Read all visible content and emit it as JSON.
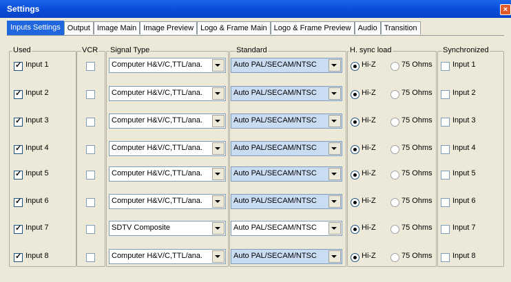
{
  "window": {
    "title": "Settings",
    "close_glyph": "×"
  },
  "tabs": [
    "Inputs Settings",
    "Output",
    "Image Main",
    "Image Preview",
    "Logo & Frame Main",
    "Logo & Frame Preview",
    "Audio",
    "Transition"
  ],
  "group_labels": {
    "used": "Used",
    "vcr": "VCR",
    "signal": "Signal Type",
    "standard": "Standard",
    "hsync": "H. sync load",
    "sync": "Synchronized"
  },
  "radio_labels": {
    "hiz": "Hi-Z",
    "ohm": "75 Ohms"
  },
  "rows": [
    {
      "used": "Input 1",
      "signal": "Computer H&V/C,TTL/ana.",
      "standard": "Auto PAL/SECAM/NTSC",
      "sync": "Input 1"
    },
    {
      "used": "Input 2",
      "signal": "Computer H&V/C,TTL/ana.",
      "standard": "Auto PAL/SECAM/NTSC",
      "sync": "Input 2"
    },
    {
      "used": "Input 3",
      "signal": "Computer H&V/C,TTL/ana.",
      "standard": "Auto PAL/SECAM/NTSC",
      "sync": "Input 3"
    },
    {
      "used": "Input 4",
      "signal": "Computer H&V/C,TTL/ana.",
      "standard": "Auto PAL/SECAM/NTSC",
      "sync": "Input 4"
    },
    {
      "used": "Input 5",
      "signal": "Computer H&V/C,TTL/ana.",
      "standard": "Auto PAL/SECAM/NTSC",
      "sync": "Input 5"
    },
    {
      "used": "Input 6",
      "signal": "Computer H&V/C,TTL/ana.",
      "standard": "Auto PAL/SECAM/NTSC",
      "sync": "Input 6"
    },
    {
      "used": "Input 7",
      "signal": "SDTV Composite",
      "standard": "Auto PAL/SECAM/NTSC",
      "sync": "Input 7"
    },
    {
      "used": "Input 8",
      "signal": "Computer H&V/C,TTL/ana.",
      "standard": "Auto PAL/SECAM/NTSC",
      "sync": "Input 8"
    }
  ]
}
